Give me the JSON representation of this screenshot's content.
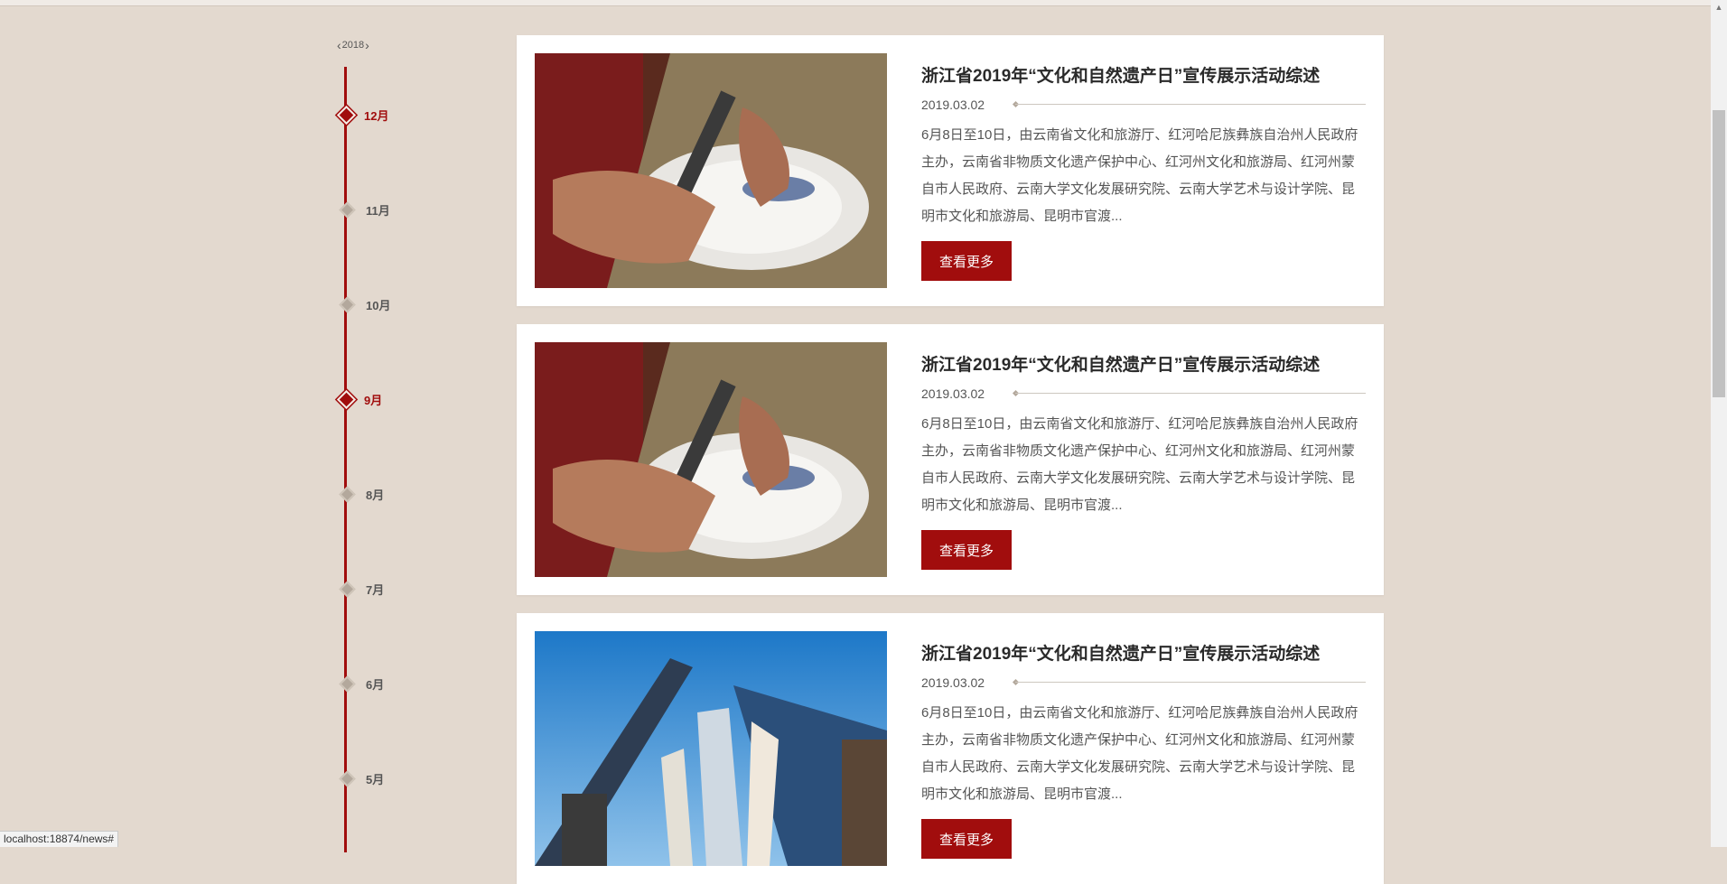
{
  "status_url": "localhost:18874/news#",
  "timeline": {
    "year": "2018",
    "prev_icon": "chevron-left-icon",
    "next_icon": "chevron-right-icon",
    "months": [
      {
        "label": "12月",
        "active": true
      },
      {
        "label": "11月",
        "active": false
      },
      {
        "label": "10月",
        "active": false
      },
      {
        "label": "9月",
        "active": true
      },
      {
        "label": "8月",
        "active": false
      },
      {
        "label": "7月",
        "active": false
      },
      {
        "label": "6月",
        "active": false
      },
      {
        "label": "5月",
        "active": false
      }
    ]
  },
  "news": [
    {
      "title": "浙江省2019年“文化和自然遗产日”宣传展示活动综述",
      "date": "2019.03.02",
      "excerpt": "6月8日至10日，由云南省文化和旅游厅、红河哈尼族彝族自治州人民政府主办，云南省非物质文化遗产保护中心、红河州文化和旅游局、红河州蒙自市人民政府、云南大学文化发展研究院、云南大学艺术与设计学院、昆明市文化和旅游局、昆明市官渡...",
      "more_label": "查看更多",
      "image": "plate-painting"
    },
    {
      "title": "浙江省2019年“文化和自然遗产日”宣传展示活动综述",
      "date": "2019.03.02",
      "excerpt": "6月8日至10日，由云南省文化和旅游厅、红河哈尼族彝族自治州人民政府主办，云南省非物质文化遗产保护中心、红河州文化和旅游局、红河州蒙自市人民政府、云南大学文化发展研究院、云南大学艺术与设计学院、昆明市文化和旅游局、昆明市官渡...",
      "more_label": "查看更多",
      "image": "plate-painting"
    },
    {
      "title": "浙江省2019年“文化和自然遗产日”宣传展示活动综述",
      "date": "2019.03.02",
      "excerpt": "6月8日至10日，由云南省文化和旅游厅、红河哈尼族彝族自治州人民政府主办，云南省非物质文化遗产保护中心、红河州文化和旅游局、红河州蒙自市人民政府、云南大学文化发展研究院、云南大学艺术与设计学院、昆明市文化和旅游局、昆明市官渡...",
      "more_label": "查看更多",
      "image": "indigo-cloth"
    }
  ],
  "colors": {
    "accent": "#a10d0d",
    "background": "#e3d9cf",
    "card": "#ffffff"
  }
}
